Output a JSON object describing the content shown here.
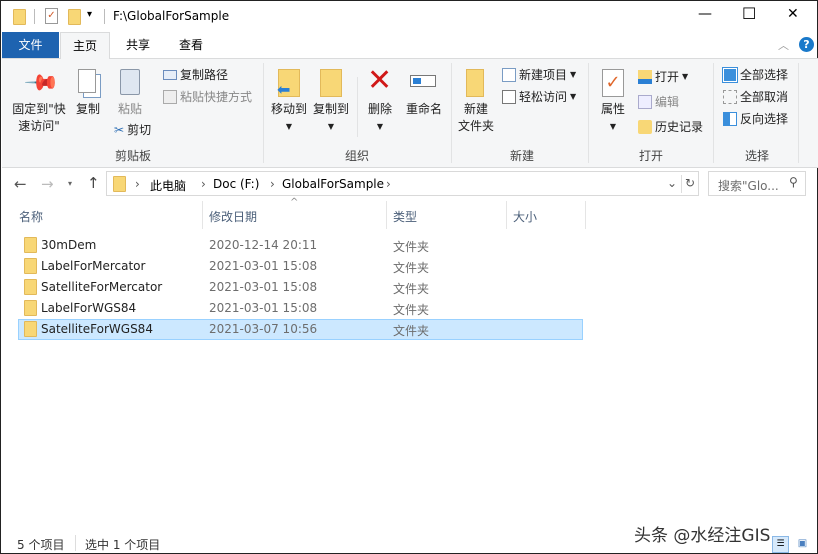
{
  "title_bar": {
    "path": "F:\\GlobalForSample",
    "minimize": "—",
    "maximize": "☐",
    "close": "✕"
  },
  "tabs": [
    {
      "label": "文件"
    },
    {
      "label": "主页"
    },
    {
      "label": "共享"
    },
    {
      "label": "查看"
    }
  ],
  "ribbon": {
    "clipboard": {
      "label": "剪贴板",
      "pin": "固定到\"快速访问\"",
      "pin_l1": "固定到\"快",
      "pin_l2": "速访问\"",
      "copy": "复制",
      "paste": "粘贴",
      "cut": "剪切",
      "copy_path": "复制路径",
      "paste_shortcut": "粘贴快捷方式"
    },
    "organize": {
      "label": "组织",
      "move_to": "移动到",
      "copy_to": "复制到",
      "delete": "删除",
      "rename": "重命名"
    },
    "new": {
      "label": "新建",
      "new_folder_l1": "新建",
      "new_folder_l2": "文件夹",
      "new_item": "新建项目",
      "easy_access": "轻松访问"
    },
    "open": {
      "label": "打开",
      "properties": "属性",
      "open": "打开",
      "edit": "编辑",
      "history": "历史记录"
    },
    "select": {
      "label": "选择",
      "select_all": "全部选择",
      "select_none": "全部取消",
      "invert": "反向选择"
    }
  },
  "address": {
    "crumbs": [
      "此电脑",
      "Doc (F:)",
      "GlobalForSample"
    ],
    "search_placeholder": "搜索\"Glo..."
  },
  "columns": [
    "名称",
    "修改日期",
    "类型",
    "大小"
  ],
  "files": [
    {
      "name": "30mDem",
      "date": "2020-12-14 20:11",
      "type": "文件夹",
      "selected": false
    },
    {
      "name": "LabelForMercator",
      "date": "2021-03-01 15:08",
      "type": "文件夹",
      "selected": false
    },
    {
      "name": "SatelliteForMercator",
      "date": "2021-03-01 15:08",
      "type": "文件夹",
      "selected": false
    },
    {
      "name": "LabelForWGS84",
      "date": "2021-03-01 15:08",
      "type": "文件夹",
      "selected": false
    },
    {
      "name": "SatelliteForWGS84",
      "date": "2021-03-07 10:56",
      "type": "文件夹",
      "selected": true
    }
  ],
  "status": {
    "count": "5 个项目",
    "selected": "选中 1 个项目"
  },
  "watermark": "头条 @水经注GIS",
  "colors": {
    "accent": "#1979ca",
    "file_tab": "#1e63b0",
    "selection": "#cce8ff"
  }
}
